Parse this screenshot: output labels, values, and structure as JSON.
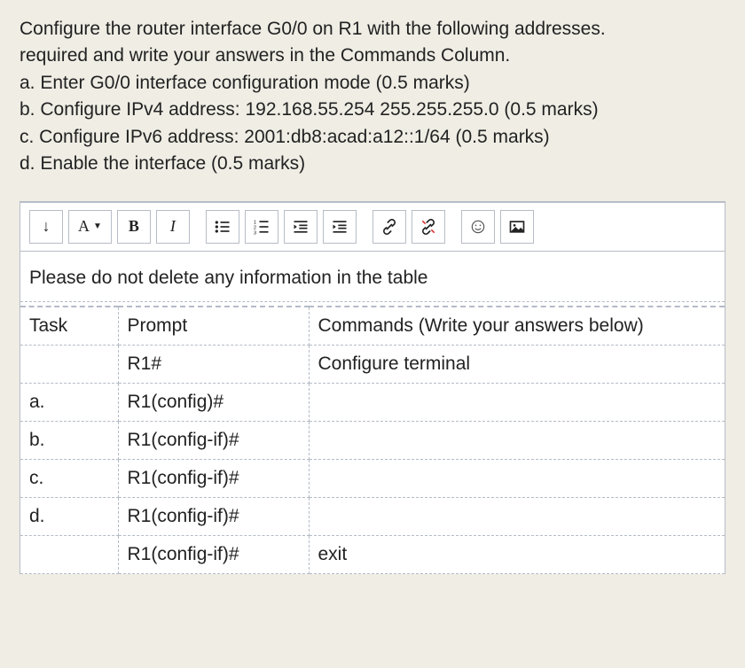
{
  "question": {
    "line1": "Configure the router interface G0/0 on R1 with the following addresses.",
    "line2": "required and write your answers in the Commands Column.",
    "a": "a. Enter G0/0 interface configuration mode (0.5 marks)",
    "b": "b. Configure IPv4 address: 192.168.55.254 255.255.255.0 (0.5 marks)",
    "c": "c. Configure IPv6 address: 2001:db8:acad:a12::1/64 (0.5 marks)",
    "d": "d. Enable the interface (0.5 marks)"
  },
  "toolbar": {
    "toggle": "↴",
    "font_label": "A",
    "bold": "B",
    "italic": "I"
  },
  "instruction": "Please do not delete any information in the table",
  "table": {
    "headers": {
      "task": "Task",
      "prompt": "Prompt",
      "commands": "Commands (Write your answers below)"
    },
    "rows": [
      {
        "task": "",
        "prompt": "R1#",
        "command": "Configure terminal"
      },
      {
        "task": "a.",
        "prompt": "R1(config)#",
        "command": ""
      },
      {
        "task": "b.",
        "prompt": "R1(config-if)#",
        "command": ""
      },
      {
        "task": "c.",
        "prompt": "R1(config-if)#",
        "command": ""
      },
      {
        "task": "d.",
        "prompt": "R1(config-if)#",
        "command": ""
      },
      {
        "task": "",
        "prompt": "R1(config-if)#",
        "command": "exit"
      }
    ]
  }
}
